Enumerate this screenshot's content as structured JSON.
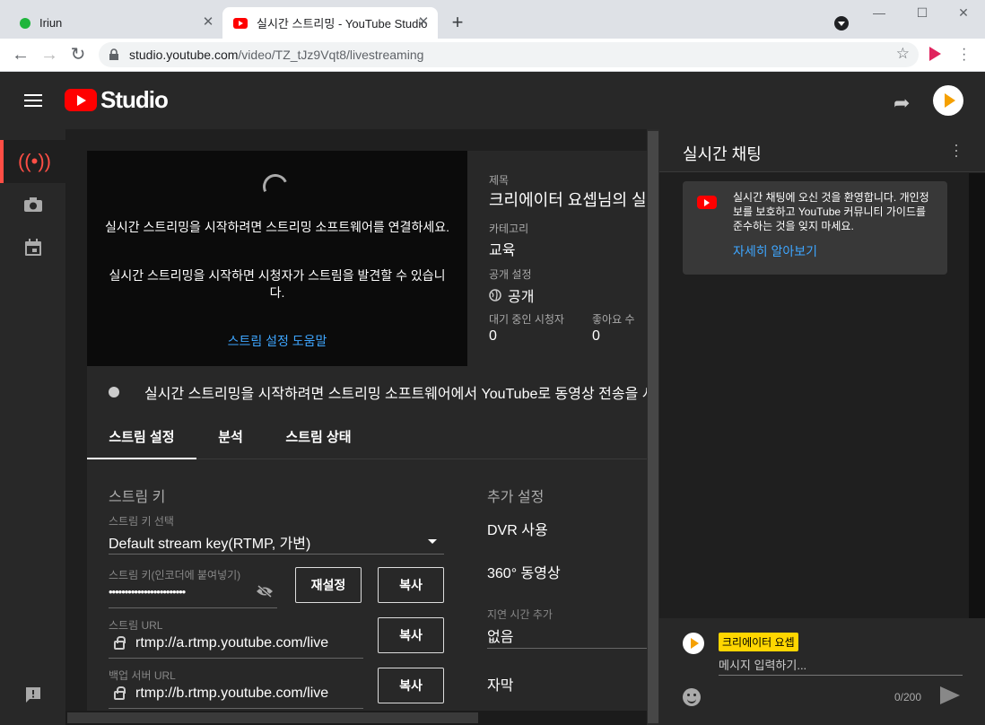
{
  "browser": {
    "tabs": [
      {
        "title": "Iriun"
      },
      {
        "title": "실시간 스트리밍 - YouTube Studio"
      }
    ],
    "url_host": "studio.youtube.com",
    "url_path": "/video/TZ_tJz9Vqt8/livestreaming",
    "newtab": "+",
    "close": "✕"
  },
  "header": {
    "studio_label": "Studio"
  },
  "preview": {
    "message1": "실시간 스트리밍을 시작하려면 스트리밍 소프트웨어를 연결하세요.",
    "message2": "실시간 스트리밍을 시작하면 시청자가 스트림을 발견할 수 있습니다.",
    "help_link": "스트림 설정 도움말"
  },
  "meta": {
    "title_label": "제목",
    "title_value": "크리에이터 요셉님의 실시간 스트림",
    "category_label": "카테고리",
    "category_value": "교육",
    "privacy_label": "공개 설정",
    "privacy_value": "공개",
    "waiting_label": "대기 중인 시청자",
    "waiting_value": "0",
    "likes_label": "좋아요 수",
    "likes_value": "0"
  },
  "status": {
    "text": "실시간 스트리밍을 시작하려면 스트리밍 소프트웨어에서 YouTube로 동영상 전송을 시작하세요."
  },
  "settings": {
    "tabs": [
      "스트림 설정",
      "분석",
      "스트림 상태"
    ],
    "stream_key_section": "스트림 키",
    "key_select_label": "스트림 키 선택",
    "key_select_value": "Default stream key(RTMP, 가변)",
    "key_label": "스트림 키(인코더에 붙여넣기)",
    "key_value": "••••••••••••••••••••••••",
    "reset_button": "재설정",
    "copy_button": "복사",
    "url_label": "스트림 URL",
    "url_value": "rtmp://a.rtmp.youtube.com/live",
    "backup_label": "백업 서버 URL",
    "backup_value": "rtmp://b.rtmp.youtube.com/live",
    "extra_section": "추가 설정",
    "dvr": "DVR 사용",
    "video360": "360° 동영상",
    "latency_label": "지연 시간 추가",
    "latency_value": "없음",
    "captions": "자막"
  },
  "chat": {
    "title": "실시간 채팅",
    "welcome_text": "실시간 채팅에 오신 것을 환영합니다. 개인정보를 보호하고 YouTube 커뮤니티 가이드를 준수하는 것을 잊지 마세요.",
    "learn_more": "자세히 알아보기",
    "author": "크리에이터 요셉",
    "input_placeholder": "메시지 입력하기...",
    "counter": "0/200"
  },
  "icons": {
    "live": "broadcast-icon",
    "camera": "camera-icon",
    "calendar": "calendar-icon",
    "feedback": "feedback-icon"
  }
}
